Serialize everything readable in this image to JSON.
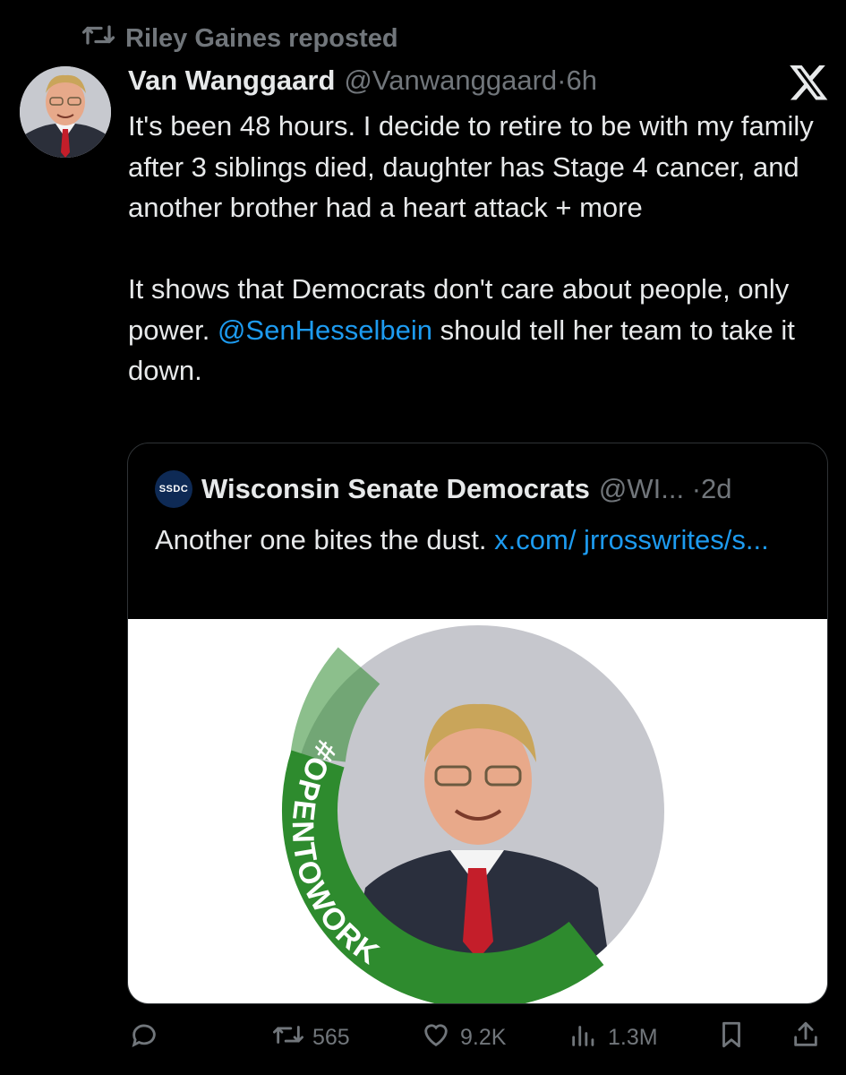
{
  "repost": {
    "icon": "repost-icon",
    "label": "Riley Gaines reposted"
  },
  "post": {
    "author_name": "Van Wanggaard",
    "author_handle": "@Vanwanggaard",
    "separator": "·",
    "time": "6h",
    "avatar_icon": "avatar",
    "platform_icon": "x-logo-icon",
    "paragraph1": "It's been 48 hours. I decide to retire to be with my family after 3 siblings died, daughter has Stage 4 cancer, and another brother had a heart attack + more",
    "paragraph2_before": "It shows that Democrats don't care about people, only power. ",
    "mention": "@SenHesselbein",
    "paragraph2_after": " should tell her team to take it down."
  },
  "quote": {
    "badge": "SSDC",
    "name": "Wisconsin Senate Democrats",
    "handle": "@WI...",
    "separator": "·",
    "time": "2d",
    "text": "Another one bites the dust. ",
    "link": "x.com/ jrrosswrites/s...",
    "image_ring_text": "#OPENTOWORK",
    "ring_color": "#2e8b2e"
  },
  "actions": {
    "reply_icon": "reply-icon",
    "repost_icon": "repost-icon",
    "repost_count": "565",
    "like_icon": "heart-icon",
    "like_count": "9.2K",
    "views_icon": "views-icon",
    "views_count": "1.3M",
    "bookmark_icon": "bookmark-icon",
    "share_icon": "share-icon"
  },
  "colors": {
    "background": "#000000",
    "text": "#e7e9ea",
    "muted": "#71767b",
    "link": "#1d9bf0"
  }
}
